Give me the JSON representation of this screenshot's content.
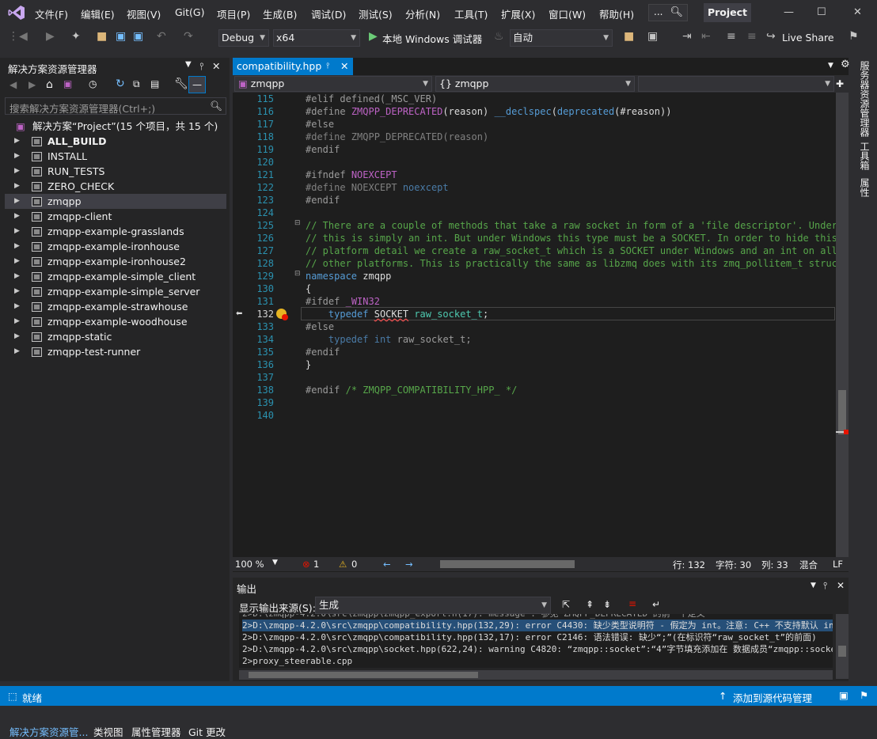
{
  "menubar": {
    "items": [
      "文件(F)",
      "编辑(E)",
      "视图(V)",
      "Git(G)",
      "项目(P)",
      "生成(B)",
      "调试(D)",
      "测试(S)",
      "分析(N)",
      "工具(T)",
      "扩展(X)",
      "窗口(W)",
      "帮助(H)"
    ],
    "search_dots": "...",
    "project_title": "Project"
  },
  "toolbar": {
    "config": "Debug",
    "platform": "x64",
    "run_label": "本地 Windows 调试器",
    "auto_combo": "自动",
    "live_share": "Live Share"
  },
  "solution_explorer": {
    "title": "解决方案资源管理器",
    "search_placeholder": "搜索解决方案资源管理器(Ctrl+;)",
    "solution_label": "解决方案“Project”(15 个项目，共 15 个)",
    "projects": [
      {
        "name": "ALL_BUILD",
        "bold": true
      },
      {
        "name": "INSTALL"
      },
      {
        "name": "RUN_TESTS"
      },
      {
        "name": "ZERO_CHECK"
      },
      {
        "name": "zmqpp",
        "selected": true
      },
      {
        "name": "zmqpp-client"
      },
      {
        "name": "zmqpp-example-grasslands"
      },
      {
        "name": "zmqpp-example-ironhouse"
      },
      {
        "name": "zmqpp-example-ironhouse2"
      },
      {
        "name": "zmqpp-example-simple_client"
      },
      {
        "name": "zmqpp-example-simple_server"
      },
      {
        "name": "zmqpp-example-strawhouse"
      },
      {
        "name": "zmqpp-example-woodhouse"
      },
      {
        "name": "zmqpp-static"
      },
      {
        "name": "zmqpp-test-runner"
      }
    ],
    "bottom_tabs": [
      "解决方案资源管...",
      "类视图",
      "属性管理器",
      "Git 更改"
    ]
  },
  "editor": {
    "tab_name": "compatibility.hpp",
    "nav_left": "zmqpp",
    "nav_mid": "{} zmqpp",
    "nav_right": "",
    "line_numbers": [
      "115",
      "116",
      "117",
      "118",
      "119",
      "120",
      "121",
      "122",
      "123",
      "124",
      "125",
      "126",
      "127",
      "128",
      "129",
      "130",
      "131",
      "132",
      "133",
      "134",
      "135",
      "136",
      "137",
      "138",
      "139",
      "140"
    ],
    "current_line": "132"
  },
  "editor_status": {
    "zoom": "100 %",
    "errors": "1",
    "warnings": "0",
    "line": "行: 132",
    "char": "字符: 30",
    "col": "列: 33",
    "mode": "混合",
    "eol": "LF"
  },
  "output": {
    "title": "输出",
    "source_label": "显示输出来源(S):",
    "source_value": "生成",
    "lines": [
      "2>D:\\zmqpp-4.2.0\\src\\zmqpp\\compatibility.hpp(132,29): error C4430: 缺少类型说明符 - 假定为 int。注意: C++ 不支持默认 int",
      "2>D:\\zmqpp-4.2.0\\src\\zmqpp\\compatibility.hpp(132,17): error C2146: 语法错误: 缺少“;”(在标识符“raw_socket_t”的前面)",
      "2>D:\\zmqpp-4.2.0\\src\\zmqpp\\socket.hpp(622,24): warning C4820: “zmqpp::socket”:“4”字节填充添加在 数据成员“zmqpp::socket::",
      "2>proxy_steerable.cpp"
    ]
  },
  "right_rail": [
    "服务器资源管理器",
    "工具箱",
    "属性"
  ],
  "statusbar": {
    "ready": "就绪",
    "source_control": "添加到源代码管理"
  }
}
